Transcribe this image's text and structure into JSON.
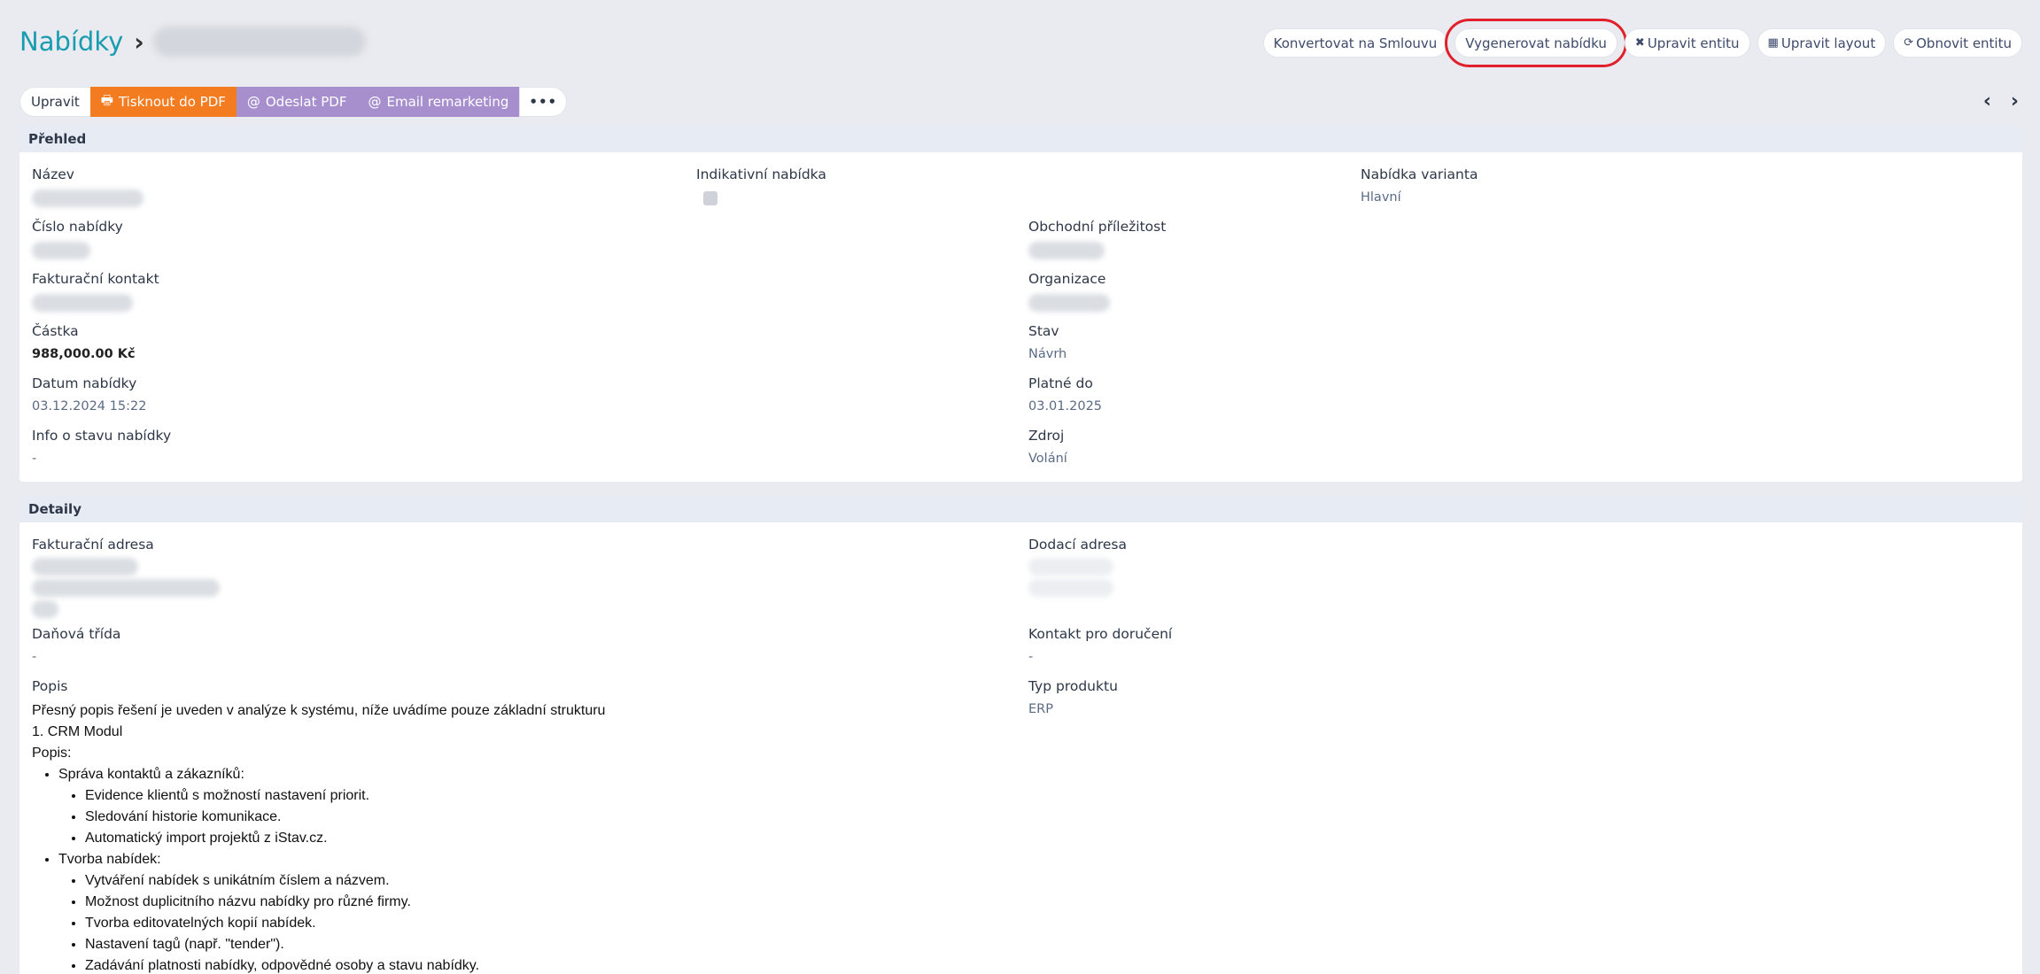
{
  "breadcrumb": {
    "root": "Nabídky",
    "separator": "›"
  },
  "header_actions": [
    {
      "label": "Konvertovat na Smlouvu",
      "icon": ""
    },
    {
      "label": "Vygenerovat nabídku",
      "icon": ""
    },
    {
      "label": "Upravit entitu",
      "icon": "wrench-icon"
    },
    {
      "label": "Upravit layout",
      "icon": "table-icon"
    },
    {
      "label": "Obnovit entitu",
      "icon": "refresh-icon"
    }
  ],
  "toolbar": {
    "edit": "Upravit",
    "print_pdf": "Tisknout do PDF",
    "send_pdf": "Odeslat PDF",
    "email_remarketing": "Email remarketing",
    "more": "•••"
  },
  "nav": {
    "prev": "‹",
    "next": "›"
  },
  "overview": {
    "title": "Přehled",
    "nazev_label": "Název",
    "indikativni_label": "Indikativní nabídka",
    "varianta_label": "Nabídka varianta",
    "varianta_value": "Hlavní",
    "cislo_label": "Číslo nabídky",
    "obchodni_label": "Obchodní příležitost",
    "fakturacni_kontakt_label": "Fakturační kontakt",
    "organizace_label": "Organizace",
    "castka_label": "Částka",
    "castka_value": "988,000.00 Kč",
    "stav_label": "Stav",
    "stav_value": "Návrh",
    "datum_label": "Datum nabídky",
    "datum_value": "03.12.2024 15:22",
    "platne_label": "Platné do",
    "platne_value": "03.01.2025",
    "info_label": "Info o stavu nabídky",
    "info_value": "-",
    "zdroj_label": "Zdroj",
    "zdroj_value": "Volání"
  },
  "details": {
    "title": "Detaily",
    "fakturacni_adresa_label": "Fakturační adresa",
    "dodaci_adresa_label": "Dodací adresa",
    "danova_label": "Daňová třída",
    "danova_value": "-",
    "kontakt_label": "Kontakt pro doručení",
    "kontakt_value": "-",
    "popis_label": "Popis",
    "typ_label": "Typ produktu",
    "typ_value": "ERP",
    "popis": {
      "intro": "Přesný popis řešení je uveden v analýze k systému, níže uvádíme pouze základní strukturu",
      "module": "1. CRM Modul",
      "popis_heading": "Popis:",
      "sections": [
        {
          "title": "Správa kontaktů a zákazníků:",
          "items": [
            "Evidence klientů s možností nastavení priorit.",
            "Sledování historie komunikace.",
            "Automatický import projektů z iStav.cz."
          ]
        },
        {
          "title": "Tvorba nabídek:",
          "items": [
            "Vytváření nabídek s unikátním číslem a názvem.",
            "Možnost duplicitního názvu nabídky pro různé firmy.",
            "Tvorba editovatelných kopií nabídek.",
            "Nastavení tagů (např. \"tender\").",
            "Zadávání platnosti nabídky, odpovědné osoby a stavu nabídky."
          ]
        }
      ]
    }
  }
}
